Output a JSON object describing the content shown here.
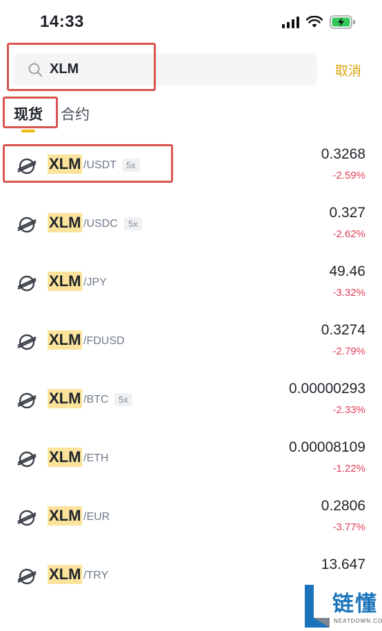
{
  "status_bar": {
    "time": "14:33"
  },
  "search": {
    "value": "XLM",
    "cancel_label": "取消"
  },
  "tabs": [
    {
      "label": "现货",
      "active": true
    },
    {
      "label": "合约",
      "active": false
    }
  ],
  "markets": [
    {
      "base": "XLM",
      "quote": "/USDT",
      "leverage": "5x",
      "price": "0.3268",
      "change": "-2.59%"
    },
    {
      "base": "XLM",
      "quote": "/USDC",
      "leverage": "5x",
      "price": "0.327",
      "change": "-2.62%"
    },
    {
      "base": "XLM",
      "quote": "/JPY",
      "leverage": null,
      "price": "49.46",
      "change": "-3.32%"
    },
    {
      "base": "XLM",
      "quote": "/FDUSD",
      "leverage": null,
      "price": "0.3274",
      "change": "-2.79%"
    },
    {
      "base": "XLM",
      "quote": "/BTC",
      "leverage": "5x",
      "price": "0.00000293",
      "change": "-2.33%"
    },
    {
      "base": "XLM",
      "quote": "/ETH",
      "leverage": null,
      "price": "0.00008109",
      "change": "-1.22%"
    },
    {
      "base": "XLM",
      "quote": "/EUR",
      "leverage": null,
      "price": "0.2806",
      "change": "-3.77%"
    },
    {
      "base": "XLM",
      "quote": "/TRY",
      "leverage": null,
      "price": "13.647",
      "change": ""
    }
  ],
  "colors": {
    "accent": "#f0b90b",
    "cancel": "#d8a30b",
    "negative": "#e0405a",
    "highlight": "#fbe39c",
    "annotation": "#d9534f"
  },
  "icons": {
    "coin": "stellar-icon",
    "search": "search-icon"
  },
  "watermark": {
    "text": "链懂",
    "sub": "NEATDOWN.COM"
  }
}
